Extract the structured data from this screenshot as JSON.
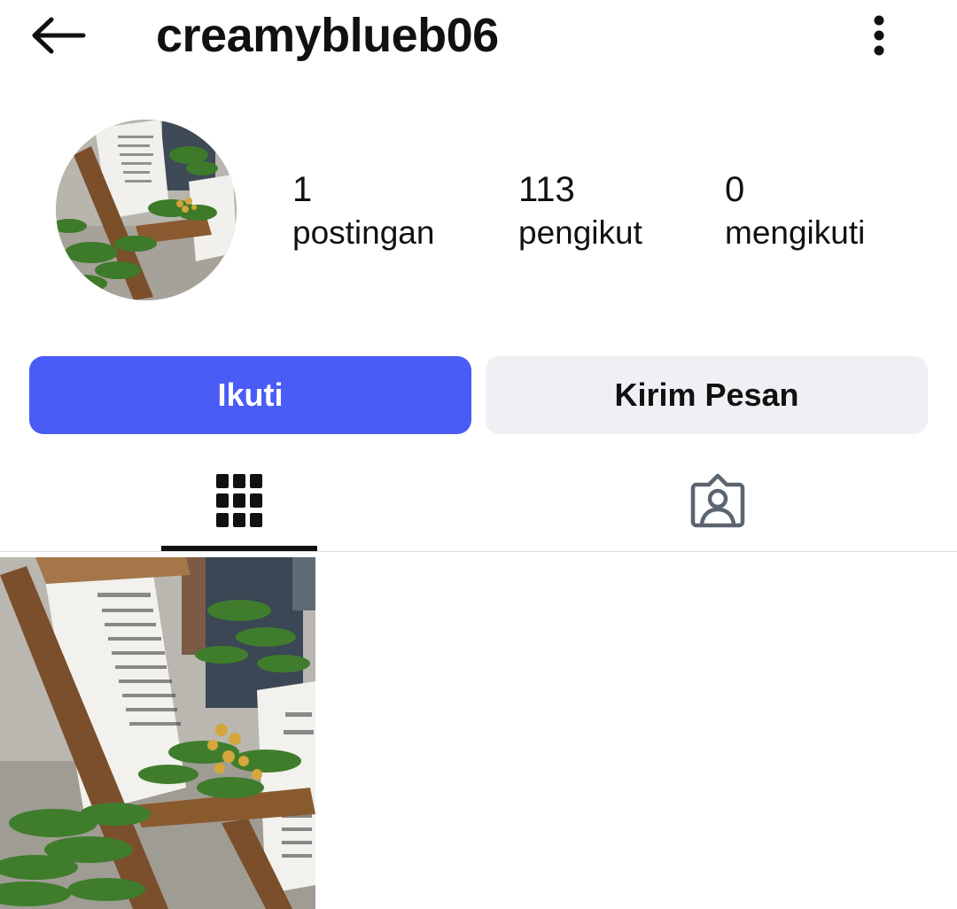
{
  "header": {
    "username": "creamyblueb06",
    "back_icon": "arrow-left-icon",
    "more_icon": "kebab-vertical-icon"
  },
  "profile": {
    "stats": [
      {
        "count": "1",
        "label": "postingan"
      },
      {
        "count": "113",
        "label": "pengikut"
      },
      {
        "count": "0",
        "label": "mengikuti"
      }
    ]
  },
  "actions": {
    "follow_label": "Ikuti",
    "message_label": "Kirim Pesan"
  },
  "tabs": {
    "grid_icon": "grid-icon",
    "tagged_icon": "tagged-person-icon",
    "active": "grid"
  },
  "colors": {
    "accent": "#4a5cf6",
    "secondary_button": "#efeff4"
  }
}
